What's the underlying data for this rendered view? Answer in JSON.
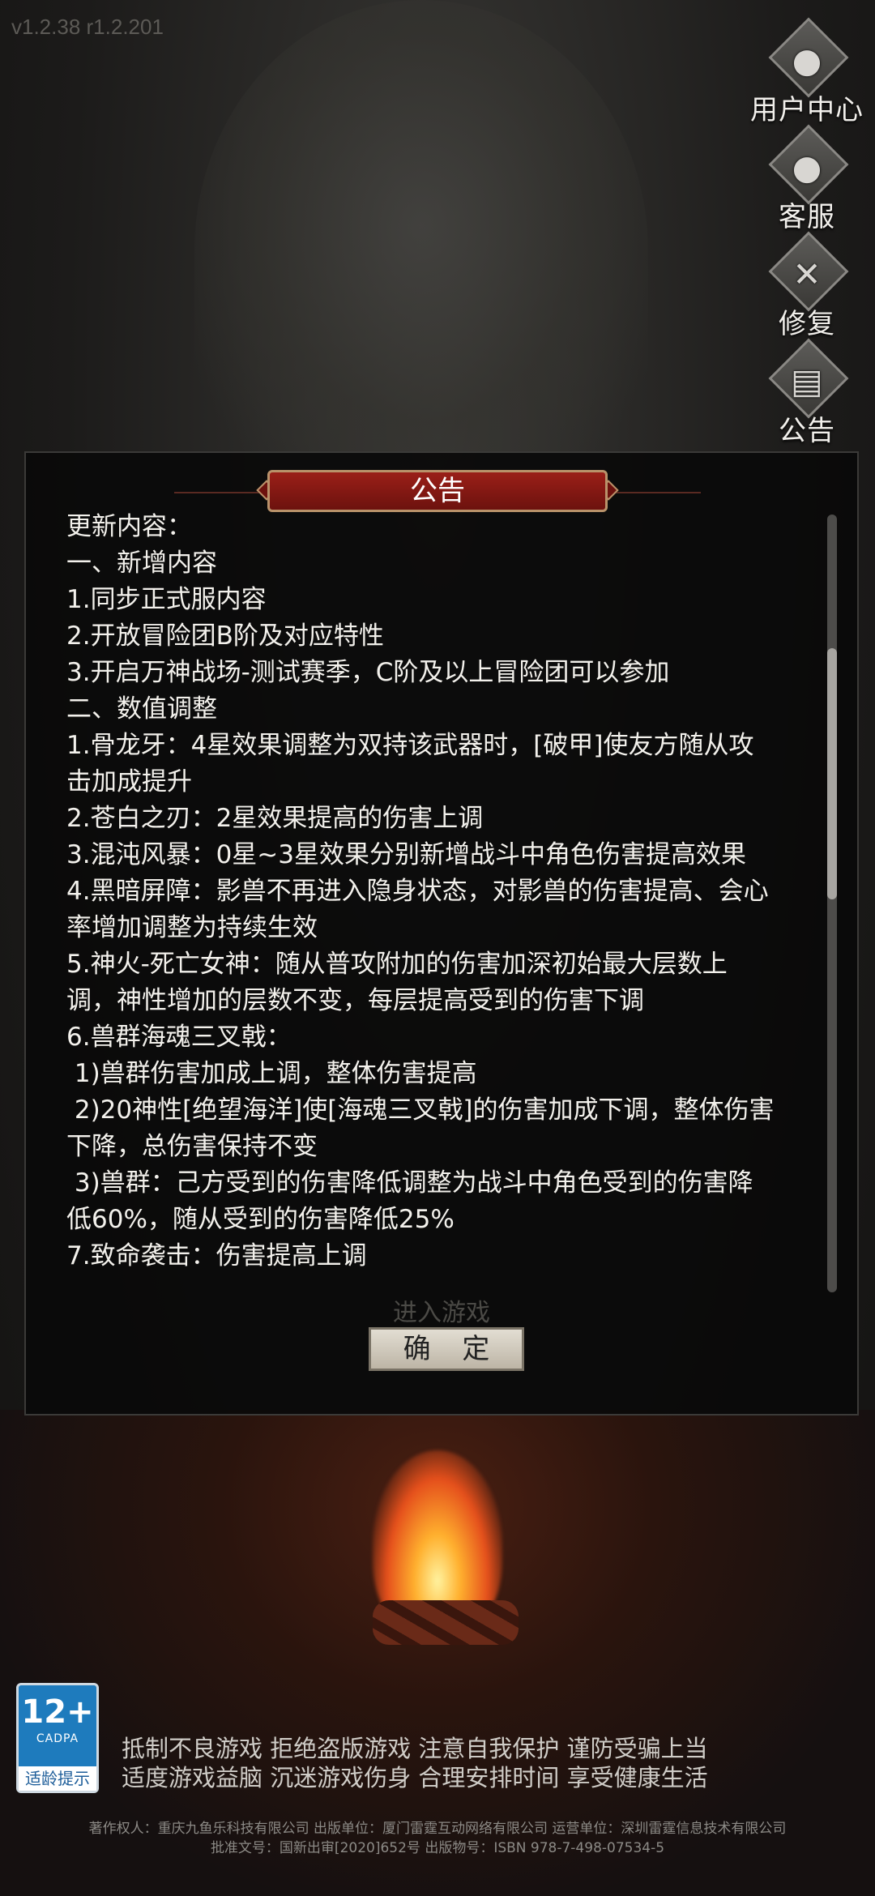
{
  "app": {
    "version": "v1.2.38 r1.2.201"
  },
  "side_menu": [
    {
      "label": "用户中心",
      "icon": "user-icon"
    },
    {
      "label": "客服",
      "icon": "support-icon"
    },
    {
      "label": "修复",
      "icon": "wrench-icon"
    },
    {
      "label": "公告",
      "icon": "notice-icon"
    }
  ],
  "dialog": {
    "title": "公告",
    "lines": [
      "更新内容：",
      "一、新增内容",
      "1.同步正式服内容",
      "2.开放冒险团B阶及对应特性",
      "3.开启万神战场-测试赛季，C阶及以上冒险团可以参加",
      "",
      "二、数值调整",
      "1.骨龙牙：4星效果调整为双持该武器时，[破甲]使友方随从攻击加成提升",
      "2.苍白之刃：2星效果提高的伤害上调",
      "3.混沌风暴：0星~3星效果分别新增战斗中角色伤害提高效果",
      "4.黑暗屏障：影兽不再进入隐身状态，对影兽的伤害提高、会心率增加调整为持续生效",
      "5.神火-死亡女神：随从普攻附加的伤害加深初始最大层数上调，神性增加的层数不变，每层提高受到的伤害下调",
      "6.兽群海魂三叉戟：",
      " 1)兽群伤害加成上调，整体伤害提高",
      " 2)20神性[绝望海洋]使[海魂三叉戟]的伤害加成下调，整体伤害下降，总伤害保持不变",
      " 3)兽群：己方受到的伤害降低调整为战斗中角色受到的伤害降低60%，随从受到的伤害降低25%",
      "7.致命袭击：伤害提高上调"
    ],
    "confirm_label": "确 定",
    "ghost_label": "进入游戏"
  },
  "age_rating": {
    "age": "12+",
    "org": "CADPA",
    "tip": "适龄提示"
  },
  "health_notice": {
    "line1": "抵制不良游戏 拒绝盗版游戏 注意自我保护 谨防受骗上当",
    "line2": "适度游戏益脑 沉迷游戏伤身 合理安排时间 享受健康生活"
  },
  "copyright": {
    "line1": "著作权人：重庆九鱼乐科技有限公司 出版单位：厦门雷霆互动网络有限公司 运营单位：深圳雷霆信息技术有限公司",
    "line2": "批准文号：国新出审[2020]652号 出版物号：ISBN 978-7-498-07534-5"
  }
}
